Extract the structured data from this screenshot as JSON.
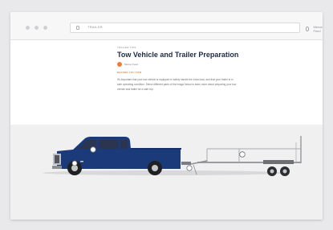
{
  "browser": {
    "url": "TRAILER",
    "right_label": "Mercer Feed"
  },
  "article": {
    "kicker": "TRAILER TIPS",
    "title": "Tow Vehicle and Trailer Preparation",
    "author": "Mercer Feed",
    "section_label": "BEFORE YOU TOW",
    "description": "It's important that your tow vehicle is equipped to safely handle the extra load, and that your trailer is in safe operating condition. Select different parts of the image below to learn more about preparing your tow vehicle and trailer for a safe trip."
  },
  "colors": {
    "truck_body": "#1b3a7a",
    "accent": "#ef7d3c",
    "title": "#1f2a44"
  },
  "hotspots": [
    "truck-cab",
    "truck-front-wheel",
    "hitch",
    "trailer-deck",
    "trailer-axle"
  ]
}
